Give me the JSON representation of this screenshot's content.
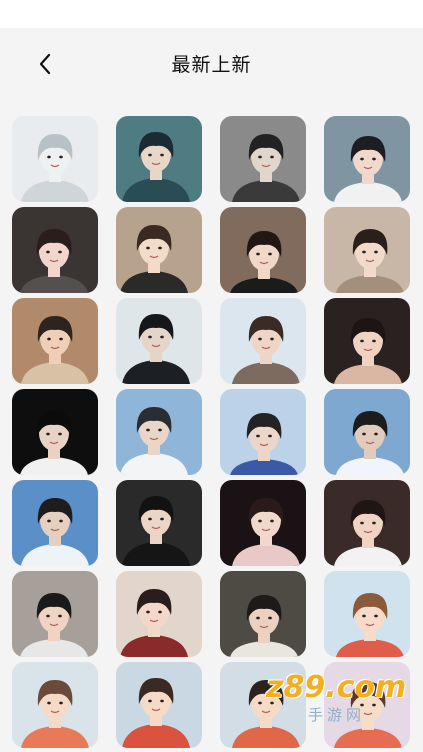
{
  "header": {
    "title": "最新上新",
    "back_icon": "chevron-left-icon"
  },
  "grid": {
    "tiles": [
      {
        "bg": "#e9ecef",
        "fg": "#cfd6da",
        "hair": "#b8c2c6",
        "skin": "#eef1f2",
        "subject": "anime-boy-white-hair"
      },
      {
        "bg": "#4e7c82",
        "fg": "#2a4d55",
        "hair": "#1c2a33",
        "skin": "#e7d7c9",
        "subject": "anime-boy-dark"
      },
      {
        "bg": "#8a8a8a",
        "fg": "#3a3a3a",
        "hair": "#222222",
        "skin": "#e0d6cc",
        "subject": "anime-boy-grayscale"
      },
      {
        "bg": "#7f96a2",
        "fg": "#f1f1f1",
        "hair": "#1d1d22",
        "skin": "#f0d8cc",
        "subject": "boy-portrait"
      },
      {
        "bg": "#3a3433",
        "fg": "#555050",
        "hair": "#2a1e1c",
        "skin": "#f2d6cc",
        "subject": "girl-portrait"
      },
      {
        "bg": "#b7a38d",
        "fg": "#2a2a2a",
        "hair": "#3a2a22",
        "skin": "#f2dcc8",
        "subject": "girl-roses"
      },
      {
        "bg": "#806b5c",
        "fg": "#1b1b1b",
        "hair": "#221813",
        "skin": "#f0d7c6",
        "subject": "girl-roses-2"
      },
      {
        "bg": "#c8b7a6",
        "fg": "#a48f7c",
        "hair": "#2a1f1a",
        "skin": "#f3d9c9",
        "subject": "girl-smile"
      },
      {
        "bg": "#b08a6a",
        "fg": "#d8c2a6",
        "hair": "#2d2420",
        "skin": "#efcfb8",
        "subject": "boy-closeup"
      },
      {
        "bg": "#dfe6ea",
        "fg": "#1c1f24",
        "hair": "#15171b",
        "skin": "#e5d4c8",
        "subject": "boy-dark-hood"
      },
      {
        "bg": "#dce6ee",
        "fg": "#7d6b5f",
        "hair": "#3a2c24",
        "skin": "#eed6c6",
        "subject": "girl-side"
      },
      {
        "bg": "#2a2220",
        "fg": "#d9b7a3",
        "hair": "#1d1513",
        "skin": "#f0d2c0",
        "subject": "girl-shoulder"
      },
      {
        "bg": "#0e0e0e",
        "fg": "#f1f1f1",
        "hair": "#0b0b0b",
        "skin": "#e8d2c4",
        "subject": "boy-black-bg"
      },
      {
        "bg": "#8fb5d8",
        "fg": "#f2f4f6",
        "hair": "#2a2d33",
        "skin": "#e9d6c8",
        "subject": "snow-boy"
      },
      {
        "bg": "#bcd2e8",
        "fg": "#3a5aa8",
        "hair": "#232323",
        "skin": "#ecd6c8",
        "subject": "snow-girl"
      },
      {
        "bg": "#7ea8d0",
        "fg": "#f1f5f9",
        "hair": "#1c1c1c",
        "skin": "#e0cbbd",
        "subject": "snow-mountain"
      },
      {
        "bg": "#5b8fc8",
        "fg": "#eef3f8",
        "hair": "#1d1d1d",
        "skin": "#e5cfc0",
        "subject": "snow-field"
      },
      {
        "bg": "#2a2a2a",
        "fg": "#151515",
        "hair": "#121212",
        "skin": "#ecd4c6",
        "subject": "boy-black-shirt"
      },
      {
        "bg": "#1a1214",
        "fg": "#e9c8c8",
        "hair": "#2b1a1a",
        "skin": "#f2d7cc",
        "subject": "girl-lights"
      },
      {
        "bg": "#3a2a28",
        "fg": "#f2f2f2",
        "hair": "#1f1513",
        "skin": "#f0d3c3",
        "subject": "girl-cat"
      },
      {
        "bg": "#a7a09a",
        "fg": "#e7e7e7",
        "hair": "#1a1a1a",
        "skin": "#f0d3c3",
        "subject": "boy-cat"
      },
      {
        "bg": "#e2d5cc",
        "fg": "#8a2a2a",
        "hair": "#2a1e1c",
        "skin": "#f3d8ca",
        "subject": "girl-butterfly"
      },
      {
        "bg": "#4e4a44",
        "fg": "#e9e6e0",
        "hair": "#1e1a18",
        "skin": "#ecd0c0",
        "subject": "boy-butterfly"
      },
      {
        "bg": "#cfe2ee",
        "fg": "#e05d4a",
        "hair": "#8a5a3a",
        "skin": "#f6dcc8",
        "subject": "anime-kids-snow"
      },
      {
        "bg": "#d9e3ea",
        "fg": "#e87a5a",
        "hair": "#6a4a3a",
        "skin": "#f5dac6",
        "subject": "anime-kids-1"
      },
      {
        "bg": "#c9d8e2",
        "fg": "#d9533e",
        "hair": "#3a2a22",
        "skin": "#f5dac6",
        "subject": "anime-kids-2"
      },
      {
        "bg": "#d2dde6",
        "fg": "#e06848",
        "hair": "#2d221e",
        "skin": "#f5dac6",
        "subject": "anime-kids-3"
      },
      {
        "bg": "#e6d9e6",
        "fg": "#e66c52",
        "hair": "#5a3a2a",
        "skin": "#f6ddca",
        "subject": "anime-kids-4"
      }
    ]
  },
  "watermark": {
    "logo_text": "z89.com",
    "sub_text": "手游网"
  }
}
